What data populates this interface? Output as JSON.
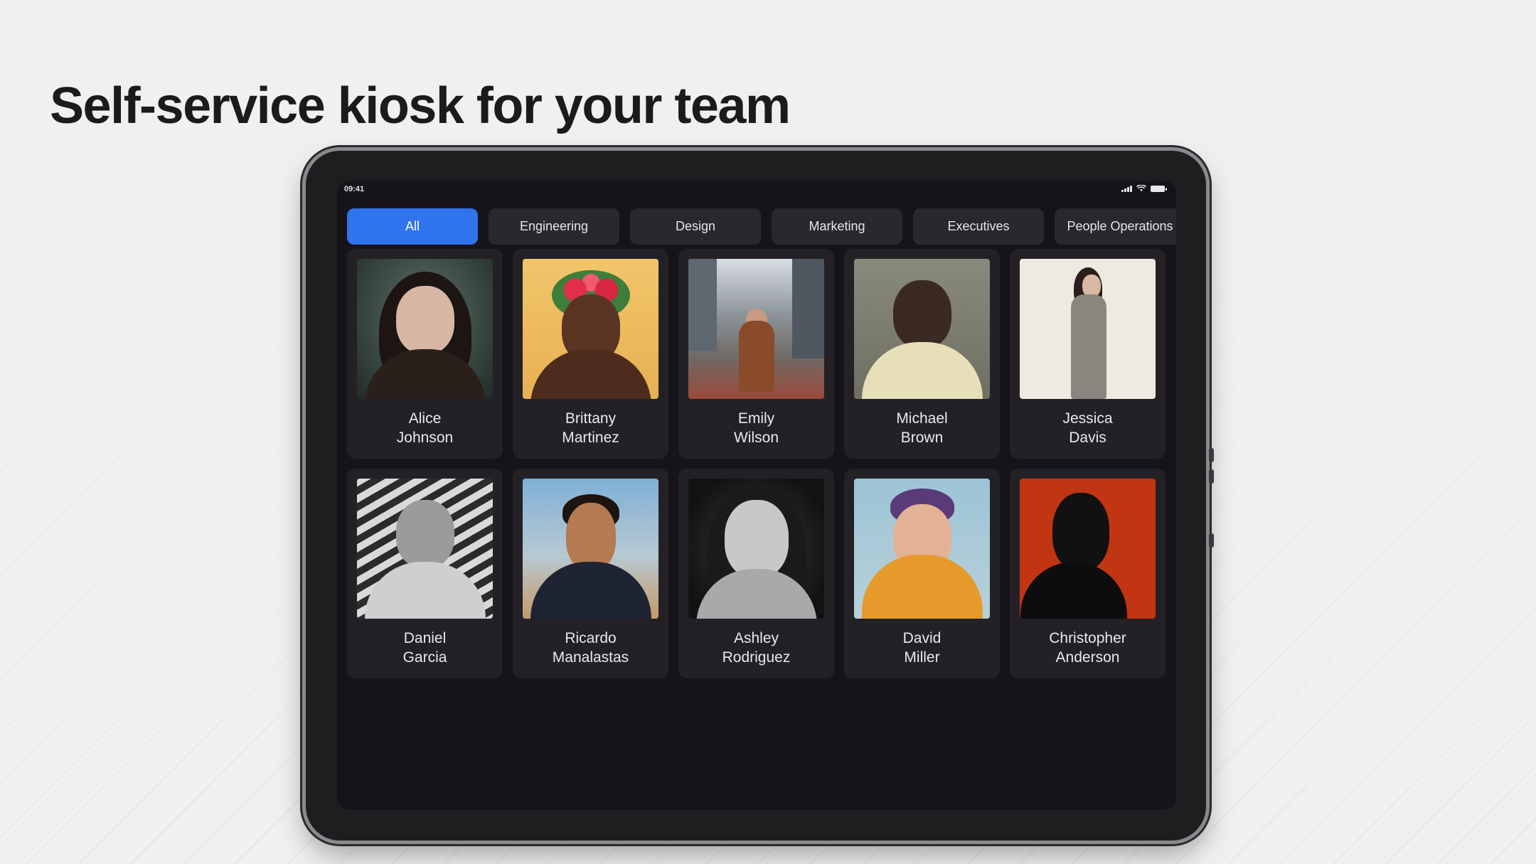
{
  "headline": "Self-service kiosk for your team",
  "status_bar": {
    "time": "09:41"
  },
  "tabs": [
    {
      "label": "All",
      "active": true
    },
    {
      "label": "Engineering",
      "active": false
    },
    {
      "label": "Design",
      "active": false
    },
    {
      "label": "Marketing",
      "active": false
    },
    {
      "label": "Executives",
      "active": false
    },
    {
      "label": "People Operations",
      "active": false
    }
  ],
  "people": [
    {
      "first": "Alice",
      "last": "Johnson"
    },
    {
      "first": "Brittany",
      "last": "Martinez"
    },
    {
      "first": "Emily",
      "last": "Wilson"
    },
    {
      "first": "Michael",
      "last": "Brown"
    },
    {
      "first": "Jessica",
      "last": "Davis"
    },
    {
      "first": "Daniel",
      "last": "Garcia"
    },
    {
      "first": "Ricardo",
      "last": "Manalastas"
    },
    {
      "first": "Ashley",
      "last": "Rodriguez"
    },
    {
      "first": "David",
      "last": "Miller"
    },
    {
      "first": "Christopher",
      "last": "Anderson"
    }
  ],
  "colors": {
    "accent": "#2f74ec",
    "screen_bg": "#161419",
    "card_bg": "#232126"
  }
}
